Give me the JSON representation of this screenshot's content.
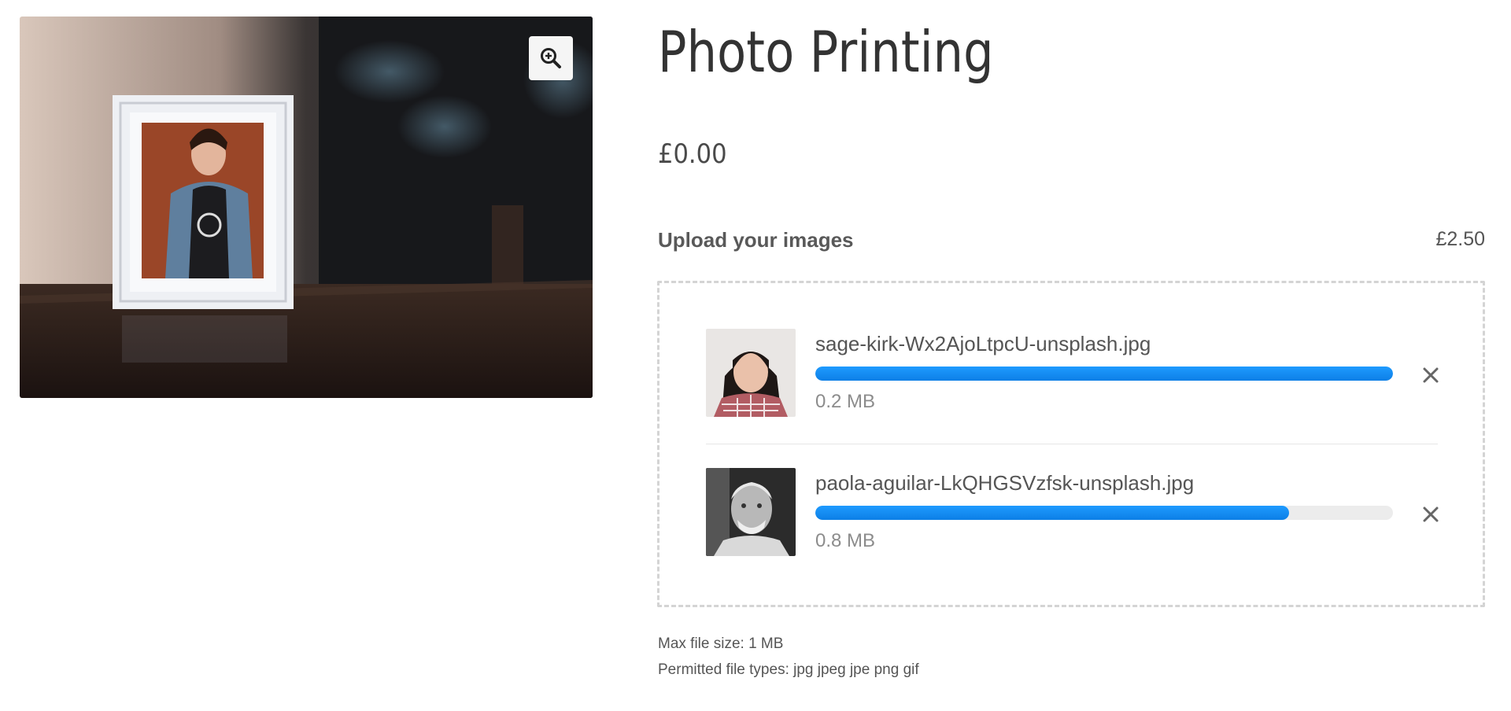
{
  "product": {
    "title": "Photo Printing",
    "price": "£0.00",
    "gallery": {
      "zoom_icon": "zoom-in-icon"
    }
  },
  "upload": {
    "label": "Upload your images",
    "price": "£2.50",
    "files": [
      {
        "name": "sage-kirk-Wx2AjoLtpcU-unsplash.jpg",
        "size": "0.2 MB",
        "progress": 1.0,
        "remove_icon": "close-icon"
      },
      {
        "name": "paola-aguilar-LkQHGSVzfsk-unsplash.jpg",
        "size": "0.8 MB",
        "progress": 0.82,
        "remove_icon": "close-icon"
      }
    ],
    "max_file_size": "Max file size: 1 MB",
    "permitted_types": "Permitted file types: jpg jpeg jpe png gif"
  },
  "colors": {
    "progress_fill": "#1489f0",
    "progress_track": "#ececec",
    "dropzone_border": "#d4d4d4"
  }
}
